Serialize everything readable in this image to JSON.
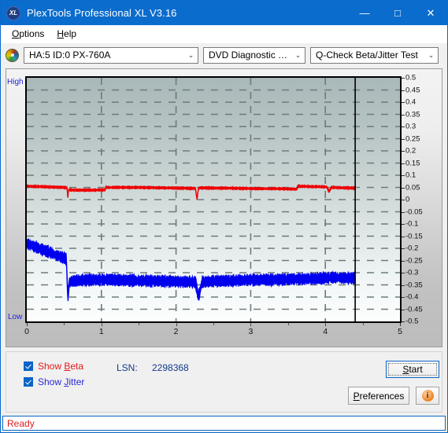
{
  "window": {
    "title": "PlexTools Professional XL V3.16",
    "icon": "xl-logo-icon",
    "minimize": "—",
    "maximize": "□",
    "close": "✕"
  },
  "menubar": {
    "items": [
      {
        "label": "Options",
        "accel": "O"
      },
      {
        "label": "Help",
        "accel": "H"
      }
    ]
  },
  "toolbar": {
    "drive_icon": "disc-icon",
    "drive": {
      "value": "HA:5 ID:0  PX-760A",
      "arrow": "⌄"
    },
    "function": {
      "value": "DVD Diagnostic Functions",
      "arrow": "⌄"
    },
    "test": {
      "value": "Q-Check Beta/Jitter Test",
      "arrow": "⌄"
    }
  },
  "chart_data": {
    "type": "line",
    "title": "Q-Check Beta/Jitter Test",
    "xlabel": "",
    "ylabel": "",
    "axis_high_label": "High",
    "axis_low_label": "Low",
    "grid": true,
    "legend_position": "bottom-left",
    "xlim": [
      0,
      5
    ],
    "ylim": [
      -0.5,
      0.5
    ],
    "xticks": [
      "0",
      "1",
      "2",
      "3",
      "4",
      "5"
    ],
    "yticks": [
      "0.5",
      "0.45",
      "0.4",
      "0.35",
      "0.3",
      "0.25",
      "0.2",
      "0.15",
      "0.1",
      "0.05",
      "0",
      "-0.05",
      "-0.1",
      "-0.15",
      "-0.2",
      "-0.25",
      "-0.3",
      "-0.35",
      "-0.4",
      "-0.45",
      "-0.5"
    ],
    "cursor_x": 4.4,
    "data_end_x": 4.4,
    "series": [
      {
        "name": "Beta",
        "color": "#ee0000",
        "x": [
          0.0,
          0.1,
          0.2,
          0.3,
          0.4,
          0.5,
          0.54,
          0.55,
          0.56,
          0.58,
          0.62,
          0.7,
          0.8,
          0.9,
          1.0,
          1.05,
          1.06,
          1.15,
          1.3,
          1.5,
          1.7,
          1.9,
          2.05,
          2.1,
          2.2,
          2.26,
          2.28,
          2.3,
          2.32,
          2.34,
          2.4,
          2.55,
          2.7,
          2.9,
          3.1,
          3.3,
          3.5,
          3.62,
          3.63,
          3.75,
          3.9,
          4.02,
          4.05,
          4.08,
          4.1,
          4.2,
          4.3,
          4.4
        ],
        "y": [
          0.055,
          0.054,
          0.053,
          0.052,
          0.051,
          0.05,
          0.049,
          0.005,
          0.04,
          0.04,
          0.039,
          0.039,
          0.039,
          0.039,
          0.04,
          0.04,
          0.05,
          0.05,
          0.05,
          0.05,
          0.049,
          0.048,
          0.047,
          0.047,
          0.046,
          0.046,
          0.0,
          0.046,
          0.048,
          0.048,
          0.048,
          0.047,
          0.047,
          0.046,
          0.045,
          0.045,
          0.044,
          0.043,
          0.055,
          0.054,
          0.053,
          0.052,
          0.032,
          0.05,
          0.05,
          0.049,
          0.048,
          0.047
        ]
      },
      {
        "name": "Jitter",
        "color": "#0000ee",
        "x": [
          0.0,
          0.05,
          0.1,
          0.15,
          0.2,
          0.25,
          0.3,
          0.35,
          0.4,
          0.45,
          0.5,
          0.53,
          0.55,
          0.57,
          0.6,
          0.7,
          0.8,
          0.9,
          1.0,
          1.1,
          1.2,
          1.3,
          1.4,
          1.5,
          1.6,
          1.7,
          1.8,
          1.9,
          2.0,
          2.1,
          2.2,
          2.26,
          2.3,
          2.35,
          2.45,
          2.6,
          2.8,
          3.0,
          3.2,
          3.4,
          3.6,
          3.8,
          4.0,
          4.1,
          4.2,
          4.3,
          4.4
        ],
        "y": [
          -0.18,
          -0.186,
          -0.192,
          -0.198,
          -0.204,
          -0.21,
          -0.216,
          -0.222,
          -0.228,
          -0.234,
          -0.24,
          -0.244,
          -0.4,
          -0.34,
          -0.335,
          -0.332,
          -0.33,
          -0.33,
          -0.329,
          -0.329,
          -0.33,
          -0.331,
          -0.332,
          -0.333,
          -0.334,
          -0.334,
          -0.335,
          -0.335,
          -0.336,
          -0.337,
          -0.338,
          -0.338,
          -0.4,
          -0.338,
          -0.336,
          -0.334,
          -0.332,
          -0.33,
          -0.329,
          -0.328,
          -0.326,
          -0.325,
          -0.322,
          -0.32,
          -0.321,
          -0.322,
          -0.323
        ]
      }
    ],
    "band_halfwidth": {
      "Beta": 0.004,
      "Jitter": 0.017
    }
  },
  "controls": {
    "show_beta": {
      "label_pre": "Show ",
      "accel": "B",
      "label_post": "eta",
      "checked": true
    },
    "show_jitter": {
      "label_pre": "Show ",
      "accel": "J",
      "label_post": "itter",
      "checked": true
    },
    "lsn_label": "LSN:",
    "lsn_value": "2298368",
    "start": {
      "label_pre": "",
      "accel": "S",
      "label_post": "tart"
    },
    "preferences": {
      "label_pre": "",
      "accel": "P",
      "label_post": "references"
    },
    "info": {
      "glyph": "i"
    }
  },
  "statusbar": {
    "text": "Ready"
  },
  "colors": {
    "title_bar": "#0a6ccd",
    "beta": "#ee0000",
    "jitter": "#0000ee",
    "axis_label": "#2121dd",
    "status": "#e01b1b",
    "window_border": "#0a68c9"
  }
}
